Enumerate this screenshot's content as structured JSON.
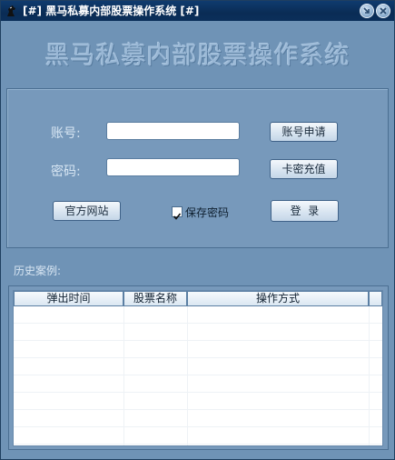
{
  "window": {
    "title": "[#] 黑马私募内部股票操作系统 [#]",
    "icons": [
      "horse-logo-icon",
      "minimize-icon",
      "close-icon"
    ]
  },
  "banner": {
    "title": "黑马私募内部股票操作系统"
  },
  "login": {
    "account_label": "账号:",
    "account_value": "",
    "password_label": "密码:",
    "password_value": "",
    "apply_account_button": "账号申请",
    "card_recharge_button": "卡密充值",
    "official_site_button": "官方网站",
    "save_password_label": "保存密码",
    "save_password_checked": true,
    "login_button": "登  录"
  },
  "history": {
    "label": "历史案例:",
    "columns": [
      "弹出时间",
      "股票名称",
      "操作方式",
      ""
    ],
    "rows": []
  },
  "colors": {
    "window_bg": "#6f93b6",
    "titlebar": "#0b2f5a",
    "panel": "#7799bb",
    "banner_text": "#9ab8d6"
  }
}
